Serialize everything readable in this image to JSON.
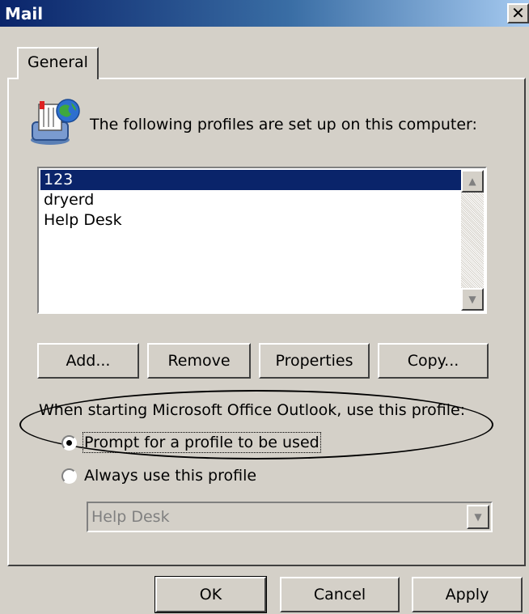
{
  "window": {
    "title": "Mail",
    "close_glyph": "✕"
  },
  "tabs": [
    {
      "label": "General",
      "selected": true
    }
  ],
  "header": {
    "icon": "mail-profiles-icon",
    "text": "The following profiles are set up on this computer:"
  },
  "profiles": {
    "items": [
      "123",
      "dryerd",
      "Help Desk"
    ],
    "selected": "123"
  },
  "scrollbar": {
    "up_glyph": "▲",
    "down_glyph": "▼"
  },
  "profile_buttons": {
    "add": "Add...",
    "remove": "Remove",
    "properties": "Properties",
    "copy": "Copy..."
  },
  "startup": {
    "label": "When starting Microsoft Office Outlook, use this profile:",
    "options": [
      {
        "label": "Prompt for a profile to be used",
        "checked": true
      },
      {
        "label": "Always use this profile",
        "checked": false
      }
    ],
    "profile_select": {
      "value": "Help Desk",
      "enabled": false,
      "arrow_glyph": "▼"
    }
  },
  "dialog_buttons": {
    "ok": "OK",
    "cancel": "Cancel",
    "apply": "Apply"
  },
  "colors": {
    "selection": "#0a246a",
    "face": "#d4d0c8",
    "titlebar_start": "#0a246a",
    "titlebar_end": "#a6caf0"
  }
}
